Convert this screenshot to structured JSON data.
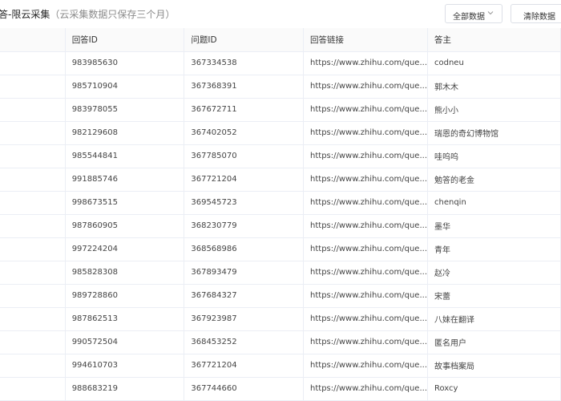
{
  "header": {
    "title": "答-限云采集",
    "subtitle": "（云采集数据只保存三个月）",
    "filter_value": "全部数据",
    "clear_label": "清除数据"
  },
  "table": {
    "columns": [
      "",
      "回答ID",
      "问题ID",
      "回答链接",
      "答主"
    ],
    "rows": [
      [
        "",
        "983985630",
        "367334538",
        "https://www.zhihu.com/que...",
        "codneu"
      ],
      [
        "",
        "985710904",
        "367368391",
        "https://www.zhihu.com/que...",
        "郭木木"
      ],
      [
        "",
        "983978055",
        "367672711",
        "https://www.zhihu.com/que...",
        "熊小小"
      ],
      [
        "",
        "982129608",
        "367402052",
        "https://www.zhihu.com/que...",
        "瑞恩的奇幻博物馆"
      ],
      [
        "",
        "985544841",
        "367785070",
        "https://www.zhihu.com/que...",
        "哇呜呜"
      ],
      [
        "",
        "991885746",
        "367721204",
        "https://www.zhihu.com/que...",
        "勉答的老金"
      ],
      [
        "",
        "998673515",
        "369545723",
        "https://www.zhihu.com/que...",
        "chenqin"
      ],
      [
        "",
        "987860905",
        "368230779",
        "https://www.zhihu.com/que...",
        "墨华"
      ],
      [
        "",
        "997224204",
        "368568986",
        "https://www.zhihu.com/que...",
        "青年"
      ],
      [
        "",
        "985828308",
        "367893479",
        "https://www.zhihu.com/que...",
        "赵冷"
      ],
      [
        "",
        "989728860",
        "367684327",
        "https://www.zhihu.com/que...",
        "宋蕾"
      ],
      [
        "",
        "987862513",
        "367923987",
        "https://www.zhihu.com/que...",
        "八妹在翻译"
      ],
      [
        "",
        "990572504",
        "368453252",
        "https://www.zhihu.com/que...",
        "匿名用户"
      ],
      [
        "",
        "994610703",
        "367721204",
        "https://www.zhihu.com/que...",
        "故事档案局"
      ],
      [
        "",
        "988683219",
        "367744660",
        "https://www.zhihu.com/que...",
        "Roxcy"
      ]
    ]
  }
}
